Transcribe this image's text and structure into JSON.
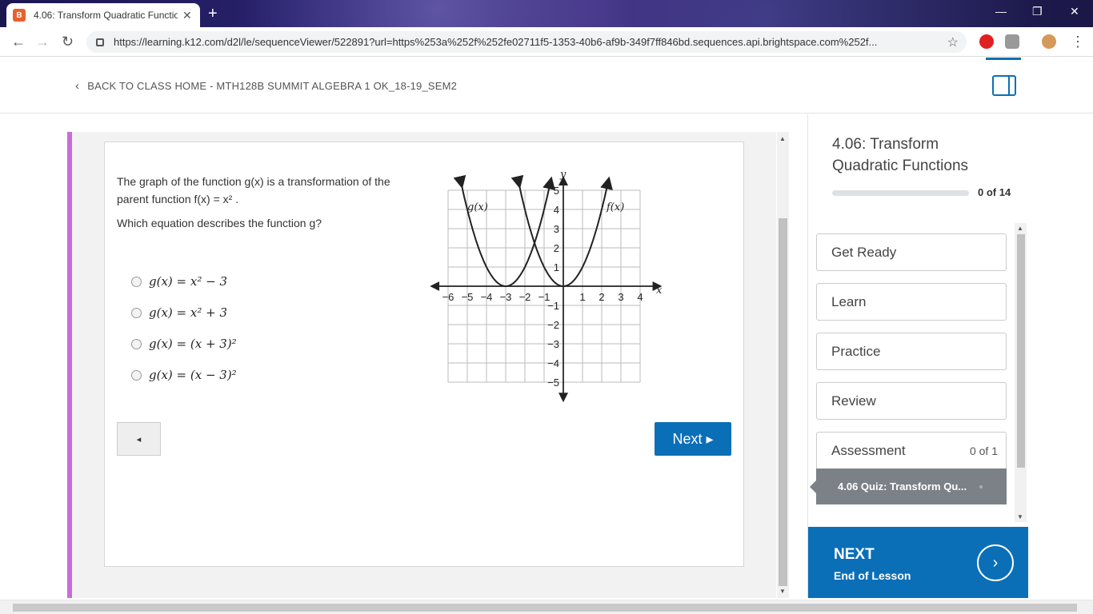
{
  "browser": {
    "tab_title": "4.06: Transform Quadratic Functio",
    "tab_favicon": "B",
    "url": "https://learning.k12.com/d2l/le/sequenceViewer/522891?url=https%253a%252f%252fe02711f5-1353-40b6-af9b-349f7ff846bd.sequences.api.brightspace.com%252f..."
  },
  "header": {
    "back_label": "BACK TO CLASS HOME - MTH128B SUMMIT ALGEBRA 1 OK_18-19_SEM2"
  },
  "question": {
    "line1": "The graph of the function g(x) is a transformation of the",
    "line2": "parent function f(x) = x² .",
    "prompt": "Which equation describes the function g?",
    "options": [
      "g(x) = x² − 3",
      "g(x) = x² + 3",
      "g(x) = (x + 3)²",
      "g(x) = (x − 3)²"
    ]
  },
  "graph": {
    "x_label": "x",
    "y_label": "y",
    "x_ticks": [
      "−6",
      "−5",
      "−4",
      "−3",
      "−2",
      "−1",
      "1",
      "2",
      "3",
      "4"
    ],
    "y_ticks": [
      "5",
      "4",
      "3",
      "2",
      "1",
      "−1",
      "−2",
      "−3",
      "−4",
      "−5"
    ],
    "curve_g_label": "g(x)",
    "curve_f_label": "f(x)"
  },
  "nav": {
    "prev_label": "◂",
    "next_label": "Next ▸"
  },
  "sidebar": {
    "lesson_title": "4.06: Transform Quadratic Functions",
    "progress_text": "0 of 14",
    "progress_fraction": 0,
    "sections": [
      "Get Ready",
      "Learn",
      "Practice",
      "Review",
      "Assessment"
    ],
    "assessment_count": "0 of 1",
    "quiz_label": "4.06 Quiz: Transform Qu...",
    "next_title": "NEXT",
    "next_sub": "End of Lesson"
  },
  "colors": {
    "accent": "#0b6fb8",
    "purple_bar": "#c86dd7"
  }
}
